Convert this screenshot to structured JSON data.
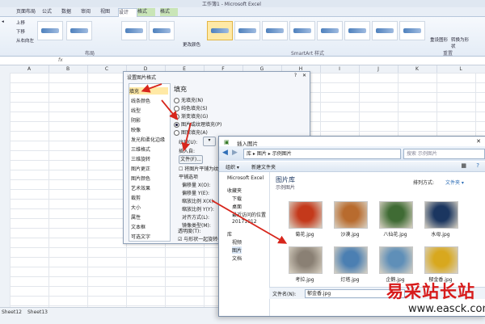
{
  "window": {
    "title": "工作簿1 - Microsoft Excel"
  },
  "tabs": [
    "页面布局",
    "公式",
    "数据",
    "审阅",
    "视图",
    "设计",
    "格式",
    "格式"
  ],
  "ribbon": {
    "left_buttons": [
      "上移",
      "下移",
      "从右向左"
    ],
    "groups": [
      "布局",
      "SmartArt 样式",
      "重置"
    ],
    "change_colors": "更改颜色",
    "reset_graphic": "重设图形",
    "convert": "转换为形状"
  },
  "sheet": {
    "columns": [
      "A",
      "B",
      "C",
      "D",
      "E",
      "F",
      "G",
      "H",
      "I",
      "J",
      "K",
      "L"
    ],
    "tabs": [
      "Sheet12",
      "Sheet13"
    ]
  },
  "format_dialog": {
    "title": "设置图片格式",
    "nav": [
      "填充",
      "线条颜色",
      "线型",
      "阴影",
      "映像",
      "发光和柔化边缘",
      "三维格式",
      "三维旋转",
      "图片更正",
      "图片颜色",
      "艺术效果",
      "裁剪",
      "大小",
      "属性",
      "文本框",
      "可选文字"
    ],
    "section": "填充",
    "options": [
      "无填充(N)",
      "纯色填充(S)",
      "渐变填充(G)",
      "图片或纹理填充(P)",
      "图案填充(A)"
    ],
    "texture_label": "纹理(U):",
    "insert_label": "插入自:",
    "file_button": "文件(F)...",
    "tile_check": "将图片平铺为纹理(I)",
    "tile_options": "平铺选项",
    "offset_x": "偏移量 X(O):",
    "offset_y": "偏移量 Y(E):",
    "scale_x": "缩放比例 X(X):",
    "scale_y": "缩放比例 Y(Y):",
    "align": "对齐方式(L):",
    "mirror": "镜像类型(M):",
    "transparency": "透明度(T):",
    "rotate_check": "与形状一起旋转(W)"
  },
  "insert_dialog": {
    "title": "插入图片",
    "breadcrumb": [
      "库",
      "图片",
      "示例图片"
    ],
    "search_placeholder": "搜索 示例图片",
    "toolbar": [
      "组织 ▾",
      "新建文件夹"
    ],
    "nav": [
      "Microsoft Excel",
      "收藏夹",
      "下载",
      "桌面",
      "最近访问的位置",
      "20171012",
      "库",
      "视频",
      "图片",
      "文档"
    ],
    "library_title": "图片库",
    "library_sub": "示例图片",
    "arrange_label": "排列方式:",
    "arrange_value": "文件夹 ▾",
    "pictures": [
      {
        "name": "菊花.jpg",
        "color": "#c4391b"
      },
      {
        "name": "沙漠.jpg",
        "color": "#b86b2e"
      },
      {
        "name": "八仙花.jpg",
        "color": "#3f6b34"
      },
      {
        "name": "水母.jpg",
        "color": "#1b3660"
      },
      {
        "name": "考拉.jpg",
        "color": "#8a8074"
      },
      {
        "name": "灯塔.jpg",
        "color": "#4b7fb2"
      },
      {
        "name": "企鹅.jpg",
        "color": "#5f8fb8"
      },
      {
        "name": "郁金香.jpg",
        "color": "#d8a81e"
      }
    ],
    "filename_label": "文件名(N):",
    "filename_value": "郁金香.jpg"
  },
  "watermark": {
    "text": "易采站长站",
    "url": "www.easck.com"
  },
  "colors": {
    "accent": "#ffe9a6",
    "arrow": "#d7261c"
  }
}
